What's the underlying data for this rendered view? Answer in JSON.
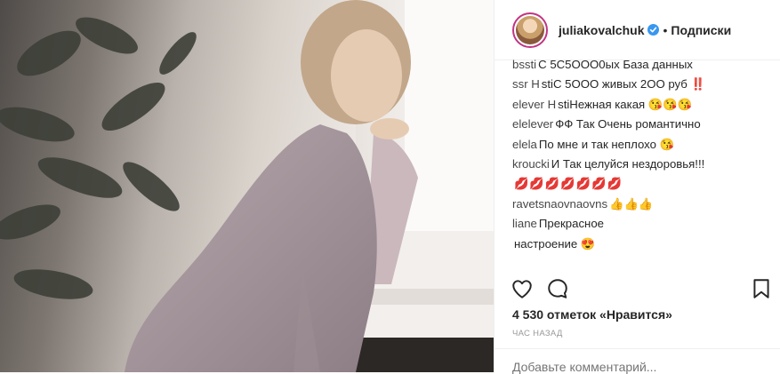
{
  "header": {
    "username": "juliakovalchuk",
    "separator": "•",
    "follow_label": "Подписки"
  },
  "comments": [
    {
      "user": "bssti",
      "text": "С 5С5ООО0ых База данных"
    },
    {
      "user": "ssr Н",
      "text": "stiС 5ООО живых 2ОО руб ‼️"
    },
    {
      "user": "elever Н",
      "text": "stiНежная какая 😘😘😘"
    },
    {
      "user": "elelever",
      "text": "ФФ Так  Очень романтично"
    },
    {
      "user": "elela",
      "text": "По мне и так неплохо 😘"
    },
    {
      "user": "kroucki",
      "text": "И Так целуйся нездоровья!!!"
    },
    {
      "user": "",
      "text": "💋💋💋💋💋💋💋"
    },
    {
      "user": "ravetsnaovnaovns",
      "text": "👍👍👍"
    },
    {
      "user": "liane",
      "text": "Прекрасное"
    },
    {
      "user": "",
      "text": "настроение 😍"
    }
  ],
  "actions": {
    "like_icon": "heart-icon",
    "comment_icon": "comment-icon",
    "save_icon": "bookmark-icon"
  },
  "likes_text": "4 530 отметок «Нравится»",
  "time_text": "ЧАС НАЗАД",
  "add_comment_placeholder": "Добавьте комментарий...",
  "colors": {
    "story_ring": "#c13584",
    "verified": "#3897f0",
    "text": "#262626",
    "muted": "#999999"
  }
}
